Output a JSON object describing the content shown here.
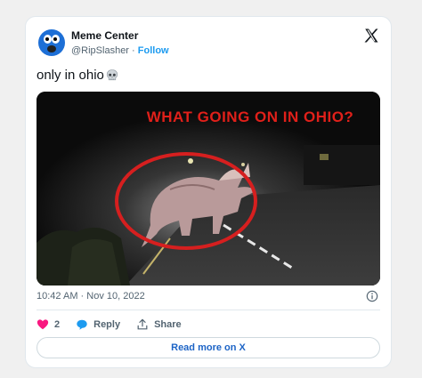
{
  "author": {
    "name": "Meme Center",
    "handle": "@RipSlasher",
    "separator": "·",
    "follow_label": "Follow"
  },
  "tweet": {
    "text": "only in ohio",
    "emoji": "skull-icon"
  },
  "media": {
    "caption": "WHAT GOING ON IN OHIO?",
    "caption_color": "#e0201a",
    "circle_color": "#d61f1f",
    "subject": "triceratops-in-road"
  },
  "meta": {
    "timestamp": "10:42 AM · Nov 10, 2022"
  },
  "actions": {
    "like_count": "2",
    "reply_label": "Reply",
    "share_label": "Share"
  },
  "read_more": {
    "label": "Read more on X"
  },
  "colors": {
    "accent": "#1d9bf0",
    "heart": "#f91880",
    "text_secondary": "#536471"
  }
}
